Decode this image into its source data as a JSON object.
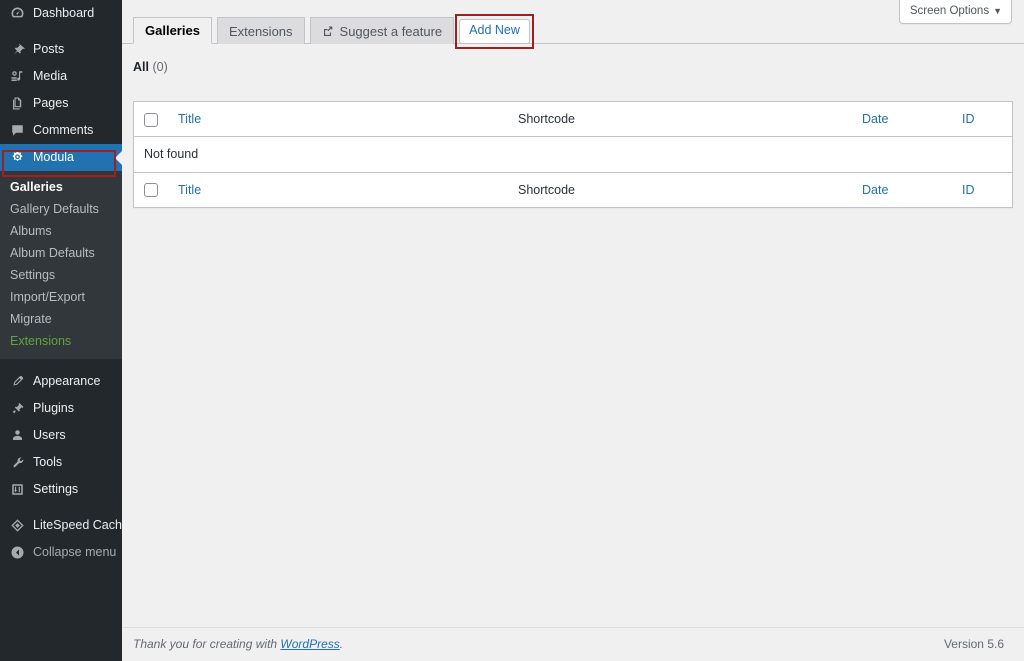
{
  "sidebar": {
    "items": [
      {
        "label": "Dashboard",
        "icon": "dashboard-icon",
        "name": "dashboard",
        "state": "normal"
      },
      {
        "label": "Posts",
        "icon": "pin-icon",
        "name": "posts",
        "state": "normal"
      },
      {
        "label": "Media",
        "icon": "media-icon",
        "name": "media",
        "state": "normal"
      },
      {
        "label": "Pages",
        "icon": "pages-icon",
        "name": "pages",
        "state": "normal"
      },
      {
        "label": "Comments",
        "icon": "comments-icon",
        "name": "comments",
        "state": "normal"
      },
      {
        "label": "Modula",
        "icon": "modula-icon",
        "name": "modula",
        "state": "current"
      }
    ],
    "submenu": [
      {
        "label": "Galleries",
        "name": "galleries",
        "state": "active"
      },
      {
        "label": "Gallery Defaults",
        "name": "gallery-defaults",
        "state": "normal"
      },
      {
        "label": "Albums",
        "name": "albums",
        "state": "normal"
      },
      {
        "label": "Album Defaults",
        "name": "album-defaults",
        "state": "normal"
      },
      {
        "label": "Settings",
        "name": "settings",
        "state": "normal"
      },
      {
        "label": "Import/Export",
        "name": "import-export",
        "state": "normal"
      },
      {
        "label": "Migrate",
        "name": "migrate",
        "state": "normal"
      },
      {
        "label": "Extensions",
        "name": "extensions",
        "state": "green"
      }
    ],
    "items_lower": [
      {
        "label": "Appearance",
        "icon": "appearance-icon",
        "name": "appearance"
      },
      {
        "label": "Plugins",
        "icon": "plugins-icon",
        "name": "plugins"
      },
      {
        "label": "Users",
        "icon": "users-icon",
        "name": "users"
      },
      {
        "label": "Tools",
        "icon": "tools-icon",
        "name": "tools"
      },
      {
        "label": "Settings",
        "icon": "settings-icon",
        "name": "settings"
      }
    ],
    "items_plugin": [
      {
        "label": "LiteSpeed Cache",
        "icon": "litespeed-icon",
        "name": "litespeed-cache"
      }
    ],
    "collapse": {
      "label": "Collapse menu",
      "icon": "collapse-icon",
      "name": "collapse-menu"
    }
  },
  "screen_options": {
    "label": "Screen Options",
    "caret": "▼"
  },
  "tabs": [
    {
      "label": "Galleries",
      "name": "galleries",
      "active": true,
      "icon": null
    },
    {
      "label": "Extensions",
      "name": "extensions",
      "active": false,
      "icon": null
    },
    {
      "label": "Suggest a feature",
      "name": "suggest-a-feature",
      "active": false,
      "icon": "external-link-icon"
    }
  ],
  "add_new": {
    "label": "Add New",
    "highlighted": true
  },
  "filters": {
    "all_label": "All",
    "all_count": "(0)"
  },
  "table": {
    "columns": [
      {
        "key": "cb",
        "label": "",
        "type": "checkbox"
      },
      {
        "key": "title",
        "label": "Title",
        "type": "link"
      },
      {
        "key": "shortcode",
        "label": "Shortcode",
        "type": "plain"
      },
      {
        "key": "date",
        "label": "Date",
        "type": "link"
      },
      {
        "key": "id",
        "label": "ID",
        "type": "link"
      }
    ],
    "empty_message": "Not found",
    "rows": []
  },
  "footer": {
    "thanks_prefix": "Thank you for creating with ",
    "wordpress_link": "WordPress",
    "thanks_suffix": ".",
    "version": "Version 5.6"
  },
  "colors": {
    "sidebar_bg": "#23282d",
    "submenu_bg": "#32373c",
    "accent_blue": "#2271b1",
    "annotation_red": "#a02020",
    "extension_green": "#62a33c",
    "content_bg": "#f0f0f1"
  }
}
